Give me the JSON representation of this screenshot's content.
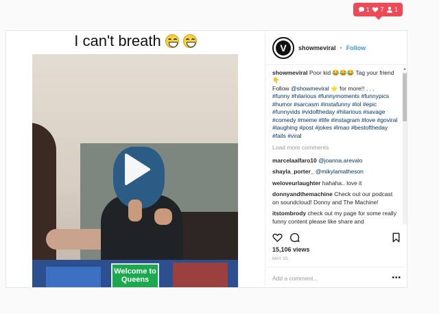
{
  "notifications": {
    "comments": "1",
    "likes": "7",
    "follows": "1"
  },
  "post": {
    "title_text": "I can't breath",
    "video_box_text": "Welcome to Queens"
  },
  "header": {
    "username": "showmeviral",
    "separator": "•",
    "follow_label": "Follow"
  },
  "caption": {
    "username": "showmeviral",
    "line1": "Poor kid 😂😂😂 Tag your friend 👇",
    "follow_prefix": "Follow",
    "mention": "@showmeviral",
    "follow_suffix": "⭐ for more!! . . .",
    "hashtags": "#funny #hilarious #funnymoments #funnypics #humor #sarcasm #instafunny #lol #epic #funnyvids #vidoftheday #hilarious #savage #comedy #meme #life #instagram #love #goviral #laughing #post #jokes #lmao #bestoftheday #fails #viral"
  },
  "load_more_label": "Load more comments",
  "comments": [
    {
      "user": "marcelaalfaro10",
      "text": "@joanna.arevalo",
      "mention": true
    },
    {
      "user": "shayla_porter_",
      "text": "@mikylamatheson",
      "mention": true
    },
    {
      "user": "weloveurlaughter",
      "text": "hahaha.. love it",
      "mention": false
    },
    {
      "user": "donnyandthemachine",
      "text": "Check out our podcast on soundcloud! Donny and The Machine!",
      "mention": false
    },
    {
      "user": "itstombrody",
      "text": "check out my page for some really funny content please like share and",
      "mention": false
    }
  ],
  "views": "15,106 views",
  "date": "MAY 25",
  "add_comment_placeholder": "Add a comment...",
  "more_options": "•••",
  "icons": [
    "comment-bubble-icon",
    "heart-icon",
    "person-icon",
    "play-icon",
    "heart-outline-icon",
    "comment-icon",
    "bookmark-icon"
  ],
  "colors": {
    "notification": "#ed4956",
    "link": "#003569",
    "follow": "#3897f0"
  }
}
